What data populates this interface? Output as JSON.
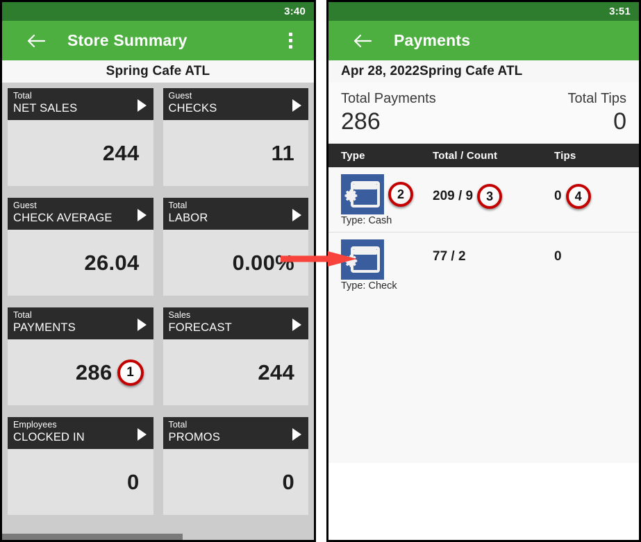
{
  "annotation": {
    "arrow_color": "#f8423c",
    "badge_ring_color": "#c30000",
    "badges": [
      "1",
      "2",
      "3",
      "4"
    ]
  },
  "theme": {
    "status_bar_green": "#2e7d2e",
    "app_bar_green": "#4caf3f",
    "tile_header_dark": "#2b2b2b",
    "tile_body_gray": "#e1e1e1",
    "grid_background": "#cccccc",
    "icon_blue": "#3a5d9e"
  },
  "left_screen": {
    "status_bar": {
      "time": "3:40"
    },
    "app_bar": {
      "back_icon": "back-arrow-icon",
      "title": "Store Summary",
      "overflow_icon": "overflow-menu-icon"
    },
    "store_name": "Spring Cafe ATL",
    "tiles": [
      {
        "category": "Total",
        "name": "NET SALES",
        "value": "244",
        "badge": null
      },
      {
        "category": "Guest",
        "name": "CHECKS",
        "value": "11",
        "badge": null
      },
      {
        "category": "Guest",
        "name": "CHECK AVERAGE",
        "value": "26.04",
        "badge": null
      },
      {
        "category": "Total",
        "name": "LABOR",
        "value": "0.00%",
        "badge": null
      },
      {
        "category": "Total",
        "name": "PAYMENTS",
        "value": "286",
        "badge": "1"
      },
      {
        "category": "Sales",
        "name": "FORECAST",
        "value": "244",
        "badge": null
      },
      {
        "category": "Employees",
        "name": "CLOCKED IN",
        "value": "0",
        "badge": null
      },
      {
        "category": "Total",
        "name": "PROMOS",
        "value": "0",
        "badge": null
      }
    ]
  },
  "right_screen": {
    "status_bar": {
      "time": "3:51"
    },
    "app_bar": {
      "back_icon": "back-arrow-icon",
      "title": "Payments"
    },
    "date_store": "Apr 28, 2022Spring Cafe ATL",
    "totals": {
      "payments_label": "Total Payments",
      "payments_value": "286",
      "tips_label": "Total Tips",
      "tips_value": "0"
    },
    "table": {
      "headers": {
        "type": "Type",
        "total_count": "Total / Count",
        "tips": "Tips"
      },
      "rows": [
        {
          "icon": "payment-card-gear-icon",
          "type_label": "Type: Cash",
          "type_badge": "2",
          "total_count": "209 / 9",
          "total_badge": "3",
          "tips": "0",
          "tips_badge": "4"
        },
        {
          "icon": "payment-card-gear-icon",
          "type_label": "Type: Check",
          "type_badge": null,
          "total_count": "77 / 2",
          "total_badge": null,
          "tips": "0",
          "tips_badge": null
        }
      ]
    }
  }
}
